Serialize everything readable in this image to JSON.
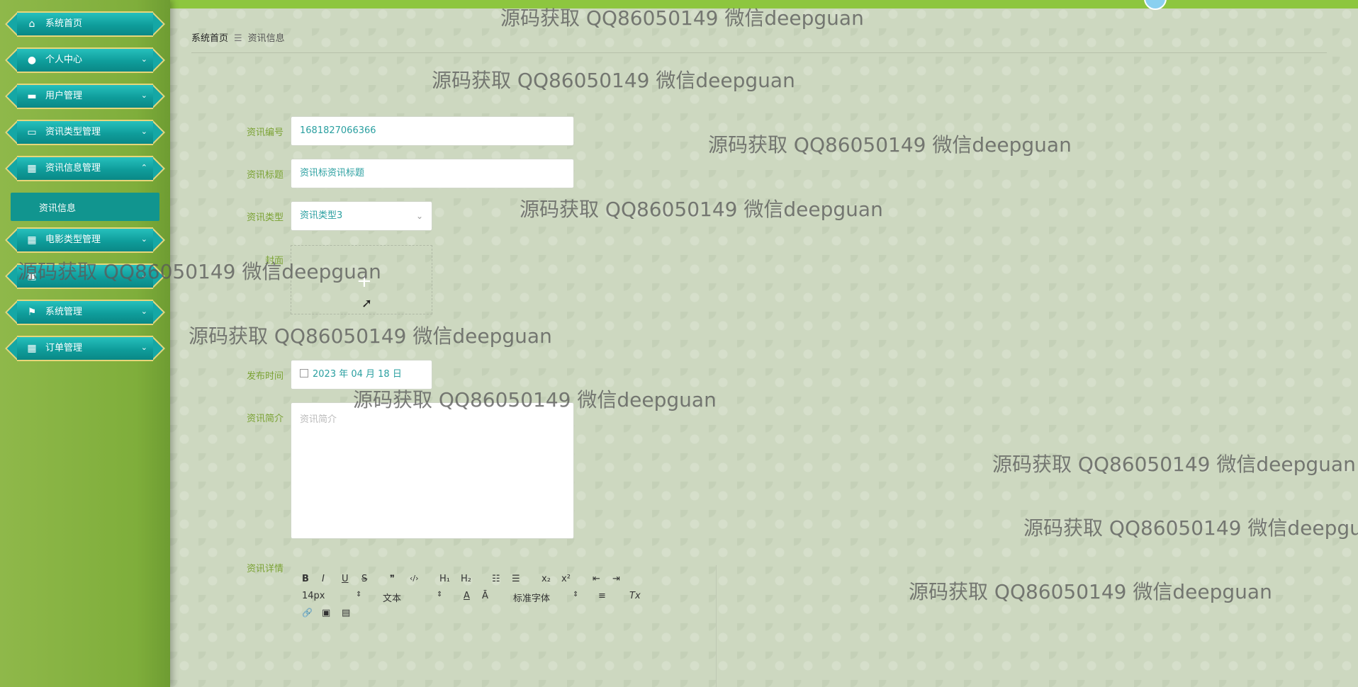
{
  "sidebar": {
    "items": [
      {
        "label": "系统首页",
        "icon": "home-icon",
        "glyph": "⌂",
        "chevron": ""
      },
      {
        "label": "个人中心",
        "icon": "user-icon",
        "glyph": "●",
        "chevron": "⌄"
      },
      {
        "label": "用户管理",
        "icon": "briefcase-icon",
        "glyph": "▬",
        "chevron": "⌄"
      },
      {
        "label": "资讯类型管理",
        "icon": "monitor-icon",
        "glyph": "▭",
        "chevron": "⌄"
      },
      {
        "label": "资讯信息管理",
        "icon": "grid-icon",
        "glyph": "▦",
        "chevron": "⌃"
      },
      {
        "label": "电影类型管理",
        "icon": "grid-icon",
        "glyph": "▦",
        "chevron": "⌄"
      },
      {
        "label": "",
        "icon": "film-icon",
        "glyph": "▣",
        "chevron": "⌄"
      },
      {
        "label": "系统管理",
        "icon": "flag-icon",
        "glyph": "⚑",
        "chevron": "⌄"
      },
      {
        "label": "订单管理",
        "icon": "grid-icon",
        "glyph": "▦",
        "chevron": "⌄"
      }
    ],
    "sub_item": "资讯信息"
  },
  "breadcrumb": {
    "home": "系统首页",
    "separator": "☰",
    "current": "资讯信息"
  },
  "form": {
    "number_label": "资讯编号",
    "number_value": "1681827066366",
    "title_label": "资讯标题",
    "title_value": "资讯标资讯标题",
    "type_label": "资讯类型",
    "type_value": "资讯类型3",
    "cover_label": "封面",
    "cover_plus": "+",
    "date_label": "发布时间",
    "date_value": "2023 年 04 月 18 日",
    "intro_label": "资讯简介",
    "intro_placeholder": "资讯简介",
    "detail_label": "资讯详情"
  },
  "editor": {
    "bold": "B",
    "italic": "I",
    "underline": "U",
    "strike": "S",
    "quote": "❞",
    "code": "‹/›",
    "h1": "H₁",
    "h2": "H₂",
    "ol": "☷",
    "ul": "☰",
    "sub": "x₂",
    "sup": "x²",
    "outdent": "⇤",
    "indent": "⇥",
    "size": "14px",
    "header": "文本",
    "color": "A",
    "background": "Ā",
    "font": "标准字体",
    "align": "≡",
    "clean": "Tx",
    "link": "🔗",
    "image": "▣",
    "video": "▤",
    "caret": "⇕"
  },
  "watermark": "源码获取 QQ86050149 微信deepguan"
}
